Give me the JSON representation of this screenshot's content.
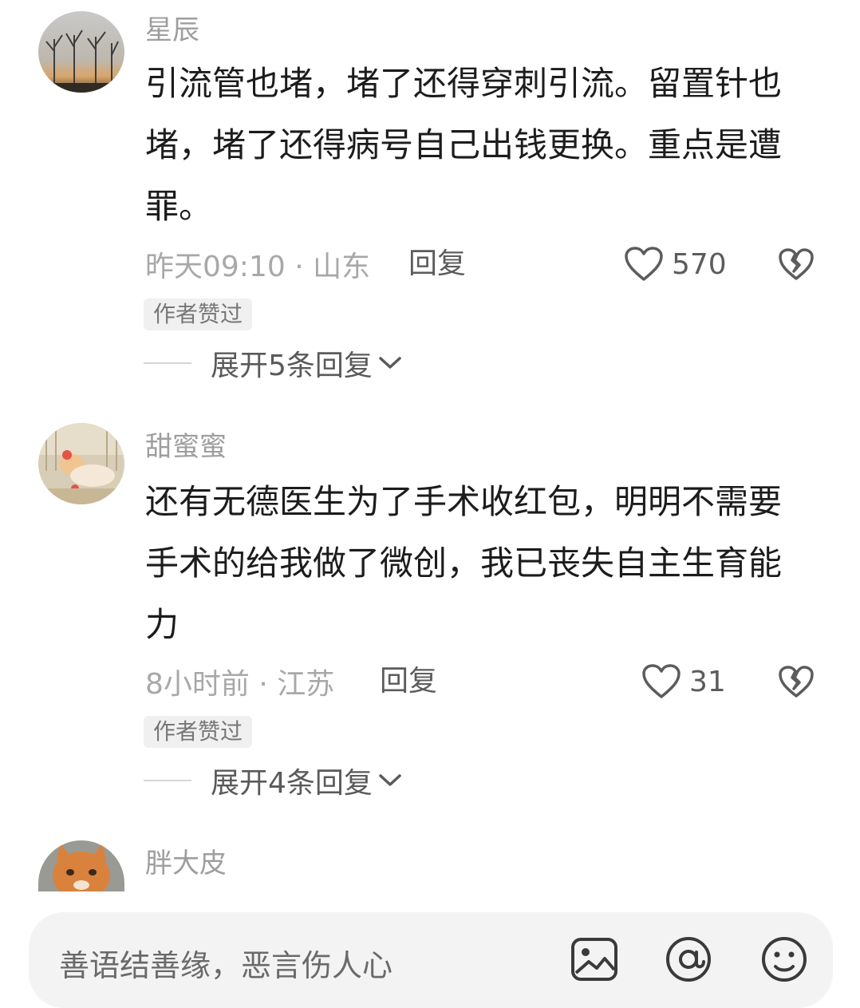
{
  "comments": [
    {
      "username": "星辰",
      "text": "引流管也堵，堵了还得穿刺引流。留置针也堵，堵了还得病号自己出钱更换。重点是遭罪。",
      "meta": "昨天09:10 · 山东",
      "reply_label": "回复",
      "likes": "570",
      "badge": "作者赞过",
      "expand_label": "展开5条回复",
      "avatar_icon": "avatar-trees-sunset"
    },
    {
      "username": "甜蜜蜜",
      "text": "还有无德医生为了手术收红包，明明不需要手术的给我做了微创，我已丧失自主生育能力",
      "meta": "8小时前 · 江苏",
      "reply_label": "回复",
      "likes": "31",
      "badge": "作者赞过",
      "expand_label": "展开4条回复",
      "avatar_icon": "avatar-baby-doll"
    },
    {
      "username": "胖大皮",
      "avatar_icon": "avatar-orange-cat"
    }
  ],
  "input_bar": {
    "placeholder": "善语结善缘，恶言伤人心",
    "icons": [
      "image-icon",
      "at-icon",
      "emoji-icon"
    ]
  },
  "colors": {
    "username": "#9e9e9e",
    "content": "#1c1c1c",
    "meta": "#a8a8a8",
    "action": "#5c5c5c",
    "badge_bg": "#f0f0f0"
  }
}
